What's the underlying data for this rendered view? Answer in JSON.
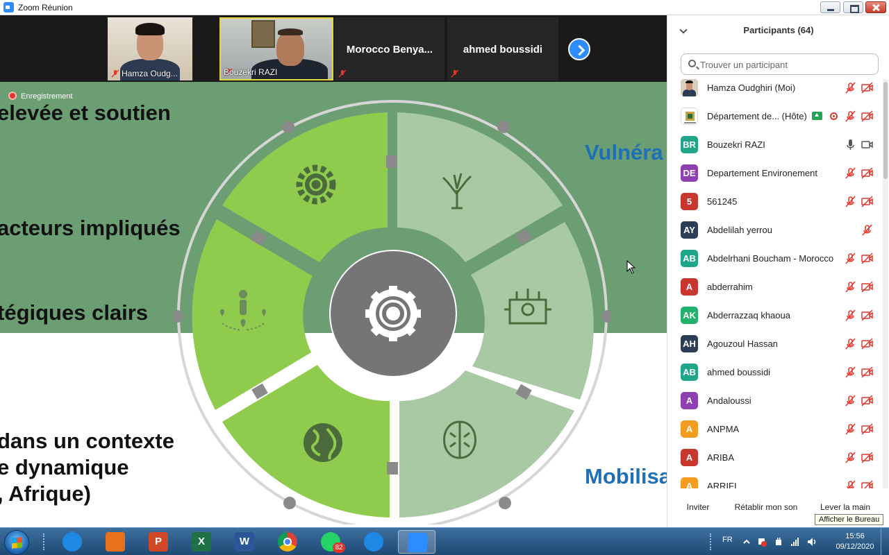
{
  "window": {
    "title": "Zoom Réunion"
  },
  "video_strip": {
    "tiles": [
      {
        "name": "Hamza Oudg..."
      },
      {
        "name": "Bouzekri RAZI"
      },
      {
        "name": "Morocco  Benya..."
      },
      {
        "name": "ahmed boussidi"
      }
    ]
  },
  "slide": {
    "recording_label": "Enregistrement",
    "left_lines": [
      "elevée et soutien",
      "acteurs impliqués",
      "tégiques clairs"
    ],
    "bottom_lines": [
      "dans un contexte",
      "e dynamique",
      ", Afrique)"
    ],
    "right_top": "Vulnéra",
    "right_bottom": "Mobilisa"
  },
  "participants": {
    "header": "Participants (64)",
    "search_placeholder": "Trouver un participant",
    "list": [
      {
        "initials": "",
        "name": "Hamza Oudghiri (Moi)",
        "color": "#6b5a4a",
        "mic": "muted",
        "cam": "off",
        "photo": true
      },
      {
        "initials": "",
        "name": "Département de...  (Hôte)",
        "color": "#ffffff",
        "mic": "muted",
        "cam": "off",
        "logo": true,
        "host": true
      },
      {
        "initials": "BR",
        "name": "Bouzekri RAZI",
        "color": "#1fa58a",
        "mic": "on",
        "cam": "on"
      },
      {
        "initials": "DE",
        "name": " Departement Environement",
        "color": "#8e3fb0",
        "mic": "muted",
        "cam": "off"
      },
      {
        "initials": "5",
        "name": "561245",
        "color": "#c8372d",
        "mic": "muted",
        "cam": "off"
      },
      {
        "initials": "AY",
        "name": "Abdelilah yerrou",
        "color": "#2c3e55",
        "mic": "muted",
        "cam": "none"
      },
      {
        "initials": "AB",
        "name": "Abdelrhani Boucham - Morocco",
        "color": "#1fa58a",
        "mic": "muted",
        "cam": "off"
      },
      {
        "initials": "A",
        "name": "abderrahim",
        "color": "#c8372d",
        "mic": "muted",
        "cam": "off"
      },
      {
        "initials": "AK",
        "name": "Abderrazzaq khaoua",
        "color": "#23b26b",
        "mic": "muted",
        "cam": "off"
      },
      {
        "initials": "AH",
        "name": "Agouzoul Hassan",
        "color": "#2c3e55",
        "mic": "muted",
        "cam": "off"
      },
      {
        "initials": "AB",
        "name": "ahmed boussidi",
        "color": "#1fa58a",
        "mic": "muted",
        "cam": "off"
      },
      {
        "initials": "A",
        "name": "Andaloussi",
        "color": "#8e3fb0",
        "mic": "muted",
        "cam": "off"
      },
      {
        "initials": "A",
        "name": "ANPMA",
        "color": "#f39c1f",
        "mic": "muted",
        "cam": "off"
      },
      {
        "initials": "A",
        "name": "ARIBA",
        "color": "#c8372d",
        "mic": "muted",
        "cam": "off"
      },
      {
        "initials": "A",
        "name": "ARRIFI",
        "color": "#f39c1f",
        "mic": "muted",
        "cam": "off"
      }
    ],
    "footer": {
      "invite": "Inviter",
      "unmute": "Rétablir mon son",
      "raise_hand": "Lever la main"
    },
    "tooltip": "Afficher le Bureau"
  },
  "taskbar": {
    "apps": [
      {
        "icon": "internet-explorer-icon",
        "color": "#1e88e5"
      },
      {
        "icon": "media-player-icon",
        "color": "#e8721c"
      },
      {
        "icon": "powerpoint-icon",
        "color": "#d24726",
        "glyph": "P"
      },
      {
        "icon": "excel-icon",
        "color": "#1e7145",
        "glyph": "X"
      },
      {
        "icon": "word-icon",
        "color": "#2b579a",
        "glyph": "W"
      },
      {
        "icon": "chrome-icon",
        "color": "#ffffff"
      },
      {
        "icon": "whatsapp-icon",
        "color": "#25d366",
        "badge": "82"
      },
      {
        "icon": "edge-icon",
        "color": "#1e88e5"
      },
      {
        "icon": "zoom-icon",
        "color": "#2d8cff"
      }
    ],
    "language": "FR",
    "time": "15:56",
    "date": "09/12/2020"
  }
}
